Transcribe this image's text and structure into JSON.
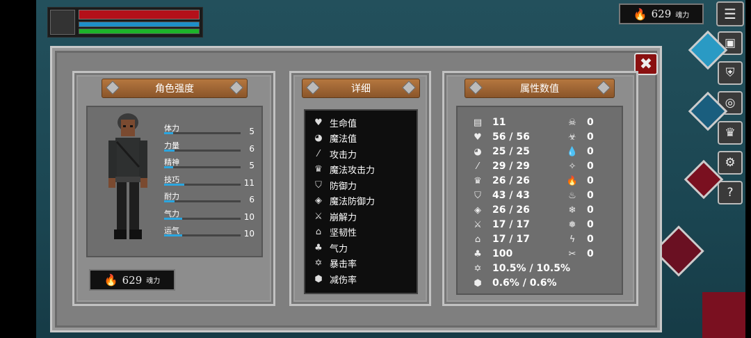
{
  "hud": {
    "hp_fraction": 1.0,
    "mp_fraction": 1.0,
    "stamina_fraction": 1.0
  },
  "souls": {
    "amount": "629",
    "unit": "魂力"
  },
  "colors": {
    "hp": "#b4101a",
    "mp": "#1e8fc8",
    "stamina": "#1db42a",
    "close": "#8a1010",
    "stat_bar": "#2aa6e0"
  },
  "panels": {
    "character": {
      "title": "角色强度"
    },
    "details": {
      "title": "详细"
    },
    "attributes": {
      "title": "属性数值"
    }
  },
  "stats": [
    {
      "label": "体力",
      "value": "5",
      "fraction": 0.12
    },
    {
      "label": "力量",
      "value": "6",
      "fraction": 0.14
    },
    {
      "label": "精神",
      "value": "5",
      "fraction": 0.12
    },
    {
      "label": "技巧",
      "value": "11",
      "fraction": 0.26
    },
    {
      "label": "耐力",
      "value": "6",
      "fraction": 0.14
    },
    {
      "label": "气力",
      "value": "10",
      "fraction": 0.24
    },
    {
      "label": "运气",
      "value": "10",
      "fraction": 0.24
    }
  ],
  "details": [
    {
      "icon": "heart-icon",
      "glyph": "♥",
      "label": "生命值"
    },
    {
      "icon": "head-icon",
      "glyph": "◕",
      "label": "魔法值"
    },
    {
      "icon": "sword-icon",
      "glyph": "⁄",
      "label": "攻击力"
    },
    {
      "icon": "crown-magic-icon",
      "glyph": "♛",
      "label": "魔法攻击力"
    },
    {
      "icon": "shield-icon",
      "glyph": "⛉",
      "label": "防御力"
    },
    {
      "icon": "magic-shield-icon",
      "glyph": "◈",
      "label": "魔法防御力"
    },
    {
      "icon": "crossed-swords-icon",
      "glyph": "⚔",
      "label": "崩解力"
    },
    {
      "icon": "helmet-icon",
      "glyph": "⌂",
      "label": "坚韧性"
    },
    {
      "icon": "lungs-icon",
      "glyph": "♣",
      "label": "气力"
    },
    {
      "icon": "star-icon",
      "glyph": "✡",
      "label": "暴击率"
    },
    {
      "icon": "damage-shield-icon",
      "glyph": "⬢",
      "label": "减伤率"
    }
  ],
  "attributes_left": [
    {
      "icon": "level-icon",
      "glyph": "▤",
      "value": "11"
    },
    {
      "icon": "heart-icon",
      "glyph": "♥",
      "value": "56 / 56"
    },
    {
      "icon": "head-icon",
      "glyph": "◕",
      "value": "25 / 25"
    },
    {
      "icon": "sword-icon",
      "glyph": "⁄",
      "value": "29 / 29"
    },
    {
      "icon": "crown-magic-icon",
      "glyph": "♛",
      "value": "26 / 26"
    },
    {
      "icon": "shield-icon",
      "glyph": "⛉",
      "value": "43 / 43"
    },
    {
      "icon": "magic-shield-icon",
      "glyph": "◈",
      "value": "26 / 26"
    },
    {
      "icon": "crossed-swords-icon",
      "glyph": "⚔",
      "value": "17 / 17"
    },
    {
      "icon": "helmet-icon",
      "glyph": "⌂",
      "value": "17 / 17"
    },
    {
      "icon": "lungs-icon",
      "glyph": "♣",
      "value": "100"
    },
    {
      "icon": "star-icon",
      "glyph": "✡",
      "value": "10.5% / 10.5%"
    },
    {
      "icon": "damage-shield-icon",
      "glyph": "⬢",
      "value": "0.6% / 0.6%"
    }
  ],
  "attributes_right": [
    {
      "icon": "skull-icon",
      "glyph": "☠",
      "value": "0"
    },
    {
      "icon": "poison-icon",
      "glyph": "☣",
      "value": "0"
    },
    {
      "icon": "blood-drop-icon",
      "glyph": "💧",
      "value": "0"
    },
    {
      "icon": "bleed-icon",
      "glyph": "✧",
      "value": "0"
    },
    {
      "icon": "fire-icon",
      "glyph": "🔥",
      "value": "0"
    },
    {
      "icon": "burn-icon",
      "glyph": "♨",
      "value": "0"
    },
    {
      "icon": "frost-icon",
      "glyph": "❄",
      "value": "0"
    },
    {
      "icon": "ice-icon",
      "glyph": "❅",
      "value": "0"
    },
    {
      "icon": "lightning-icon",
      "glyph": "ϟ",
      "value": "0"
    },
    {
      "icon": "cut-icon",
      "glyph": "✂",
      "value": "0"
    }
  ],
  "side_menu": [
    {
      "name": "menu-icon",
      "glyph": "☰"
    },
    {
      "name": "inventory-icon",
      "glyph": "▣"
    },
    {
      "name": "armor-icon",
      "glyph": "⛨"
    },
    {
      "name": "emblem-icon",
      "glyph": "◎"
    },
    {
      "name": "crown-icon",
      "glyph": "♛"
    },
    {
      "name": "settings-icon",
      "glyph": "⚙"
    },
    {
      "name": "help-icon",
      "glyph": "?"
    }
  ],
  "close_glyph": "✖",
  "flame_glyph": "🔥"
}
